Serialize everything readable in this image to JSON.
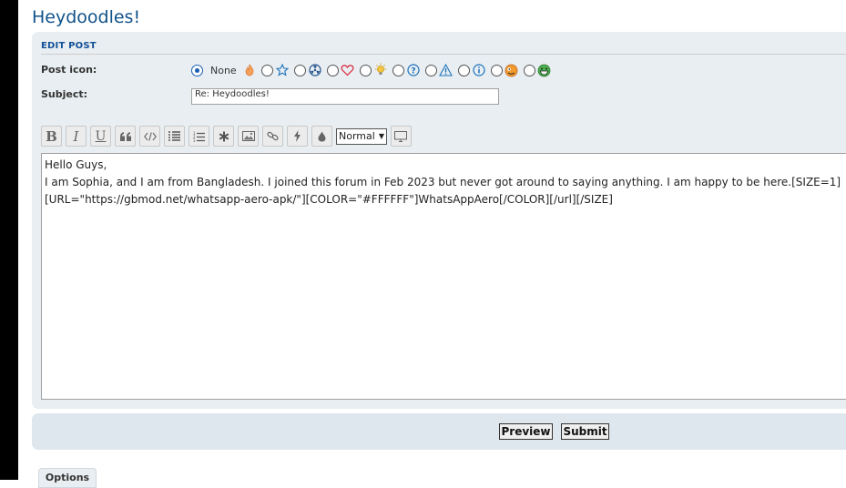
{
  "page": {
    "title": "Heydoodles!"
  },
  "edit_post": {
    "section_title": "EDIT POST",
    "post_icon_label": "Post icon:",
    "subject_label": "Subject:",
    "post_icon": {
      "none_label": "None",
      "selected": "none",
      "icons": [
        "fire-icon",
        "star-icon",
        "radioactive-icon",
        "heart-icon",
        "lightbulb-icon",
        "question-icon",
        "warning-icon",
        "info-icon",
        "mrgreen-icon",
        "grin-icon"
      ]
    },
    "subject_value": "Re: Heydoodles!",
    "font_size_value": "Normal",
    "message_text": "Hello Guys,\nI am Sophia, and I am from Bangladesh. I joined this forum in Feb 2023 but never got around to saying anything. I am happy to be here.[SIZE=1]\n[URL=\"https://gbmod.net/whatsapp-aero-apk/\"][COLOR=\"#FFFFFF\"]WhatsAppAero[/COLOR][/url][/SIZE]"
  },
  "toolbar": {
    "bold": "B",
    "italic": "I",
    "underline": "U"
  },
  "actions": {
    "preview_label": "Preview",
    "submit_label": "Submit"
  },
  "options_tab_label": "Options",
  "colors": {
    "accent": "#105289",
    "panel": "#e8eef1",
    "submit_panel": "#dee7ee"
  }
}
